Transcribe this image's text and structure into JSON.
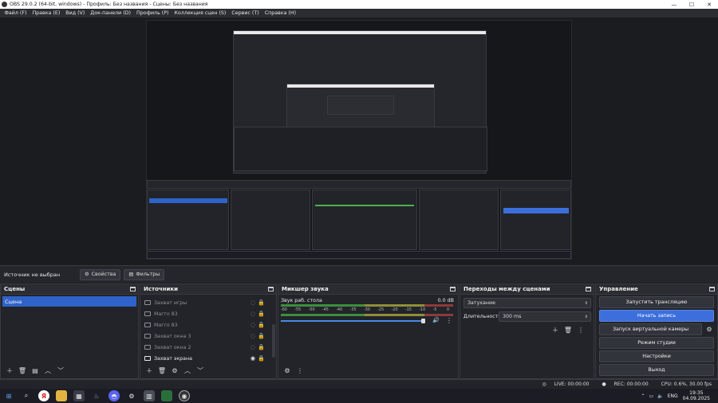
{
  "window": {
    "title": "OBS 29.0.2 (64-bit, windows) - Профиль: Без названия - Сцены: Без названия",
    "controls": [
      "minimize-icon",
      "maximize-icon",
      "close-icon"
    ]
  },
  "menu": [
    "Файл (F)",
    "Правка (E)",
    "Вид (V)",
    "Док-панели (D)",
    "Профиль (P)",
    "Коллекция сцен (S)",
    "Сервис (T)",
    "Справка (H)"
  ],
  "sourcebar": {
    "no_source": "Источник не выбран",
    "properties": "Свойства",
    "filters": "Фильтры"
  },
  "scenes": {
    "title": "Сцены",
    "items": [
      "Сцена"
    ]
  },
  "sources": {
    "title": "Источники",
    "items": [
      {
        "name": "Захват игры",
        "visible": false
      },
      {
        "name": "Магго 83",
        "visible": false
      },
      {
        "name": "Магго 83",
        "visible": false
      },
      {
        "name": "Захват окна 3",
        "visible": false
      },
      {
        "name": "Захват окна 2",
        "visible": false
      },
      {
        "name": "Захват экрана",
        "visible": true
      }
    ]
  },
  "mixer": {
    "title": "Микшер звука",
    "channel": "Звук раб. стола",
    "db": "0.0 dB",
    "ticks": [
      "-60",
      "-55",
      "-50",
      "-45",
      "-40",
      "-35",
      "-30",
      "-25",
      "-20",
      "-15",
      "-10",
      "-5",
      "0"
    ],
    "volume_level": 0.98
  },
  "transitions": {
    "title": "Переходы между сценами",
    "type": "Затухание",
    "duration_label": "Длительность",
    "duration": "300 ms"
  },
  "controls": {
    "title": "Управление",
    "buttons": [
      "Запустить трансляцию",
      "Начать запись",
      "Запуск виртуальной камеры",
      "Режим студии",
      "Настройки",
      "Выход"
    ]
  },
  "status": {
    "live": "LIVE: 00:00:00",
    "rec": "REC: 00:00:00",
    "cpu": "CPU: 0.6%, 30.00 fps"
  },
  "taskbar": {
    "lang": "ENG",
    "time": "19:35",
    "date": "04.09.2025"
  }
}
